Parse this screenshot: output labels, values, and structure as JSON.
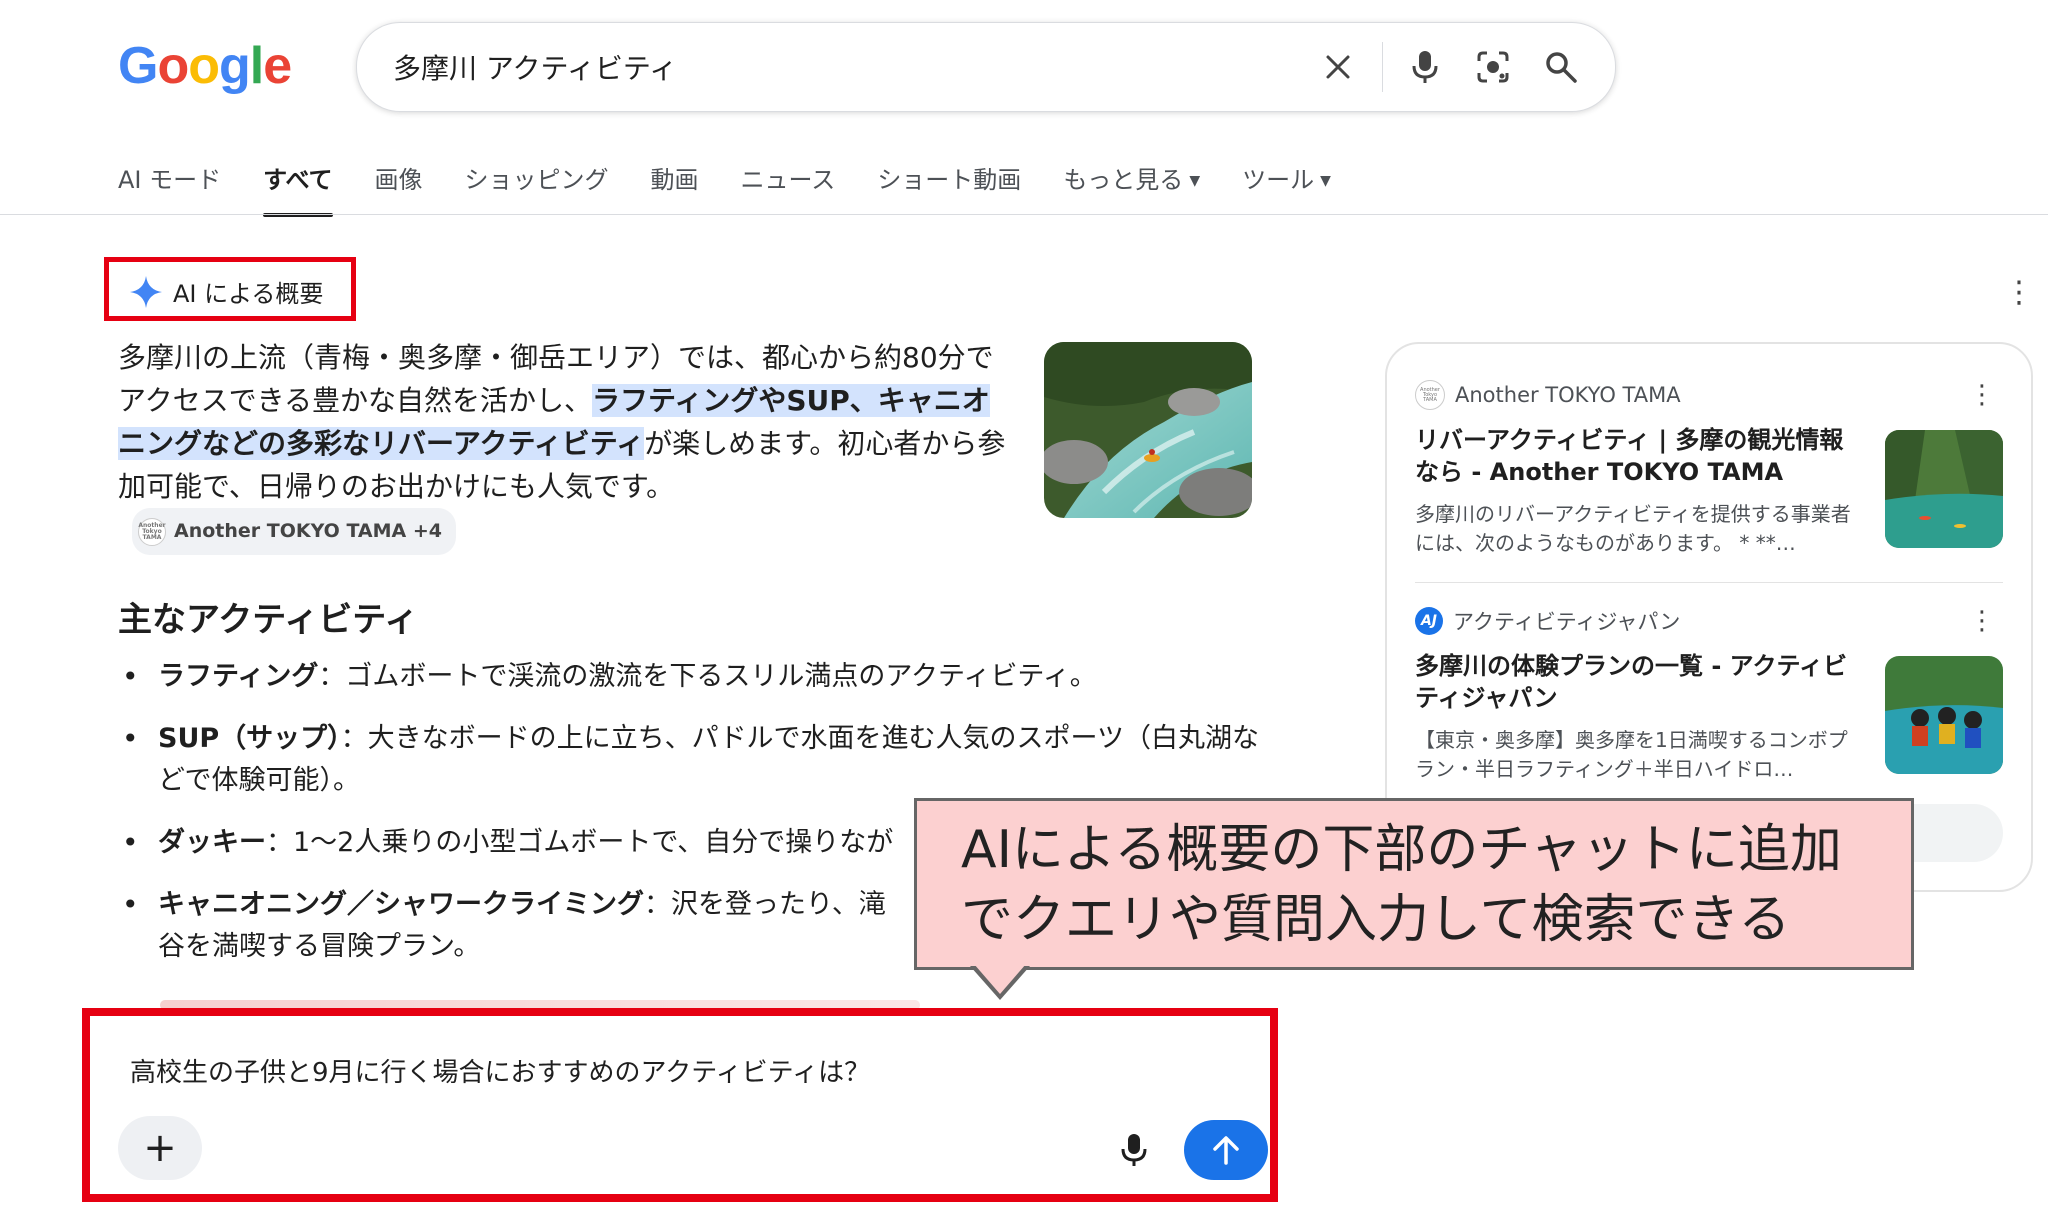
{
  "header": {
    "logo_letters": [
      {
        "ch": "G",
        "color": "#4285F4"
      },
      {
        "ch": "o",
        "color": "#EA4335"
      },
      {
        "ch": "o",
        "color": "#FBBC05"
      },
      {
        "ch": "g",
        "color": "#4285F4"
      },
      {
        "ch": "l",
        "color": "#34A853"
      },
      {
        "ch": "e",
        "color": "#EA4335"
      }
    ],
    "search_query": "多摩川 アクティビティ",
    "tabs": [
      {
        "label": "AI モード"
      },
      {
        "label": "すべて"
      },
      {
        "label": "画像"
      },
      {
        "label": "ショッピング"
      },
      {
        "label": "動画"
      },
      {
        "label": "ニュース"
      },
      {
        "label": "ショート動画"
      },
      {
        "label": "もっと見る"
      },
      {
        "label": "ツール"
      }
    ]
  },
  "ai_overview": {
    "label": "AI による概要",
    "para_1": "多摩川の上流（青梅・奥多摩・御岳エリア）では、都心から約80分でアクセスできる豊かな自然を活かし、",
    "para_highlight": "ラフティングやSUP、キャニオニングなどの多彩なリバーアクティビティ",
    "para_2": "が楽しめます。初心者から参加可能で、日帰りのお出かけにも人気です。",
    "source_chip": "Another TOKYO TAMA +4",
    "chip_logo_text": "Another Tokyo TAMA",
    "subheading": "主なアクティビティ",
    "bullets": [
      {
        "term": "ラフティング",
        "text": "：ゴムボートで渓流の激流を下るスリル満点のアクティビティ。"
      },
      {
        "term": "SUP（サップ）",
        "text": "：大きなボードの上に立ち、パドルで水面を進む人気のスポーツ（白丸湖などで体験可能）。"
      },
      {
        "term": "ダッキー",
        "text": "：1〜2人乗りの小型ゴムボートで、自分で操りなが"
      },
      {
        "term": "キャニオニング／シャワークライミング",
        "text": "：沢を登ったり、滝"
      },
      {
        "term": "",
        "text": "谷を満喫する冒険プラン。"
      }
    ]
  },
  "sources_panel": {
    "cards": [
      {
        "source": "Another TOKYO TAMA",
        "logo_text": "Another Tokyo TAMA",
        "title": "リバーアクティビティ | 多摩の観光情報なら - Another TOKYO TAMA",
        "desc": "多摩川のリバーアクティビティを提供する事業者には、次のようなものがあります。 * **…"
      },
      {
        "source": "アクティビティジャパン",
        "logo_text": "AJ",
        "title": "多摩川の体験プランの一覧 - アクティビティジャパン",
        "desc": "【東京・奥多摩】奥多摩を1日満喫するコンボプラン・半日ラフティング＋半日ハイドロ…"
      }
    ]
  },
  "callout": {
    "line_1": "AIによる概要の下部のチャットに追加",
    "line_2": "でクエリや質問入力して検索できる"
  },
  "chat": {
    "text": "高校生の子供と9月に行く場合におすすめのアクティビティは？"
  },
  "colors": {
    "highlight_box": "#e60012",
    "accent_blue": "#1a73e8",
    "highlight_text_bg": "#d3e3fd",
    "callout_bg": "#fcd0d0"
  }
}
